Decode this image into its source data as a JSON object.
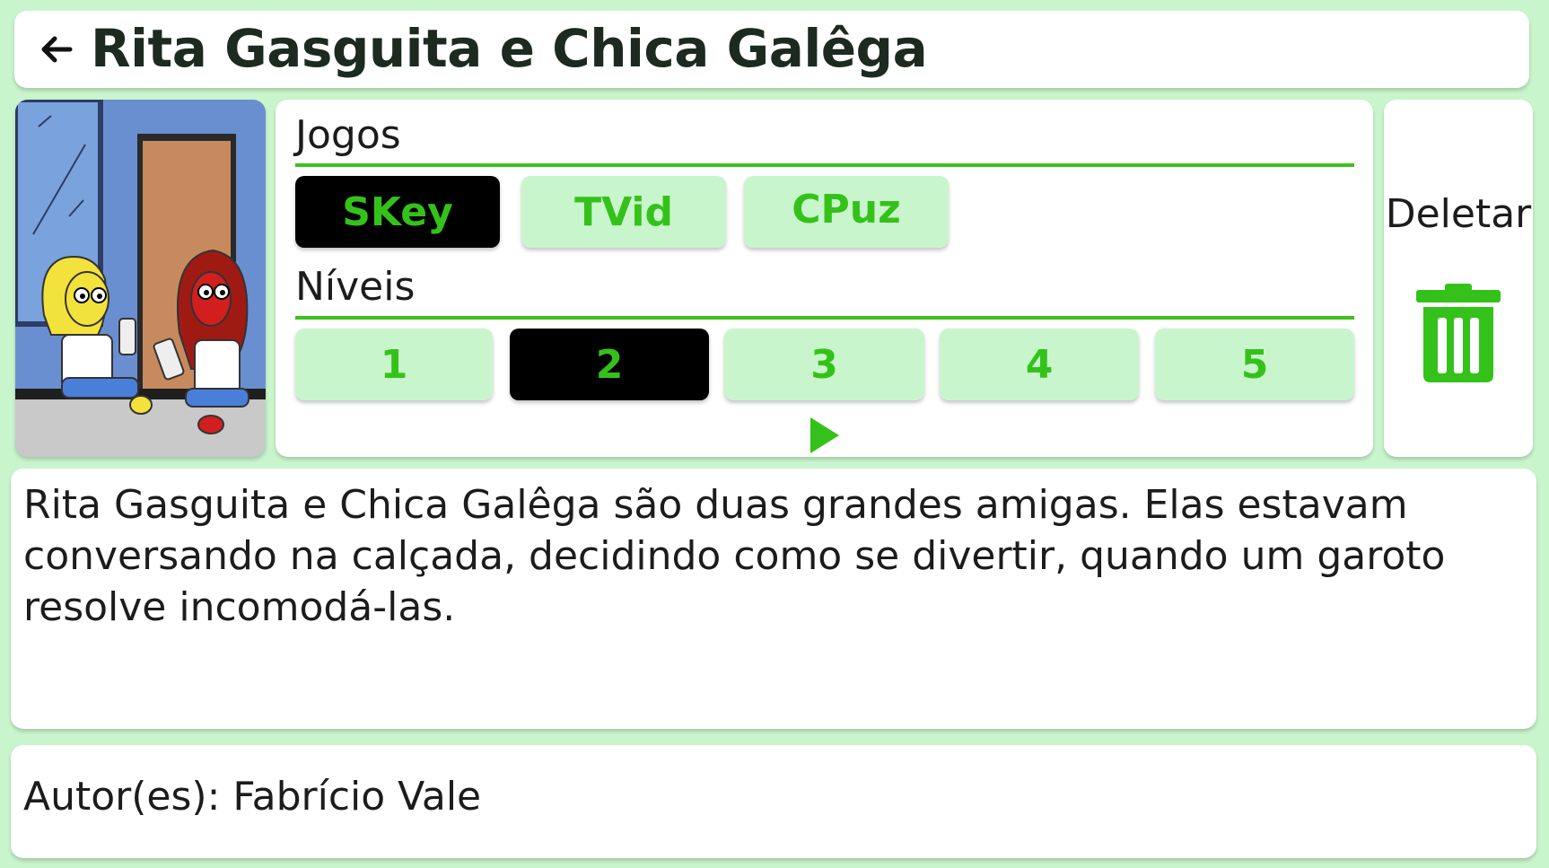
{
  "header": {
    "title": "Rita Gasguita e Chica Galêga",
    "back_icon": "arrow-left-icon"
  },
  "games": {
    "label": "Jogos",
    "items": [
      {
        "label": "SKey",
        "selected": true
      },
      {
        "label": "TVid",
        "selected": false
      },
      {
        "label": "CPuz",
        "selected": false
      }
    ]
  },
  "levels": {
    "label": "Níveis",
    "items": [
      {
        "label": "1",
        "selected": false
      },
      {
        "label": "2",
        "selected": true
      },
      {
        "label": "3",
        "selected": false
      },
      {
        "label": "4",
        "selected": false
      },
      {
        "label": "5",
        "selected": false
      }
    ],
    "play_icon": "play-icon"
  },
  "delete": {
    "label": "Deletar",
    "icon": "trash-icon"
  },
  "description": "Rita Gasguita e Chica Galêga são duas grandes amigas. Elas estavam conversando na calçada, decidindo como se divertir, quando um garoto resolve incomodá-las.",
  "author": "Autor(es): Fabrício Vale",
  "colors": {
    "background": "#c9f5cc",
    "accent": "#34c21a",
    "chip_bg": "#c9f5cc",
    "chip_selected_bg": "#000000",
    "text": "#1c1c1c"
  }
}
